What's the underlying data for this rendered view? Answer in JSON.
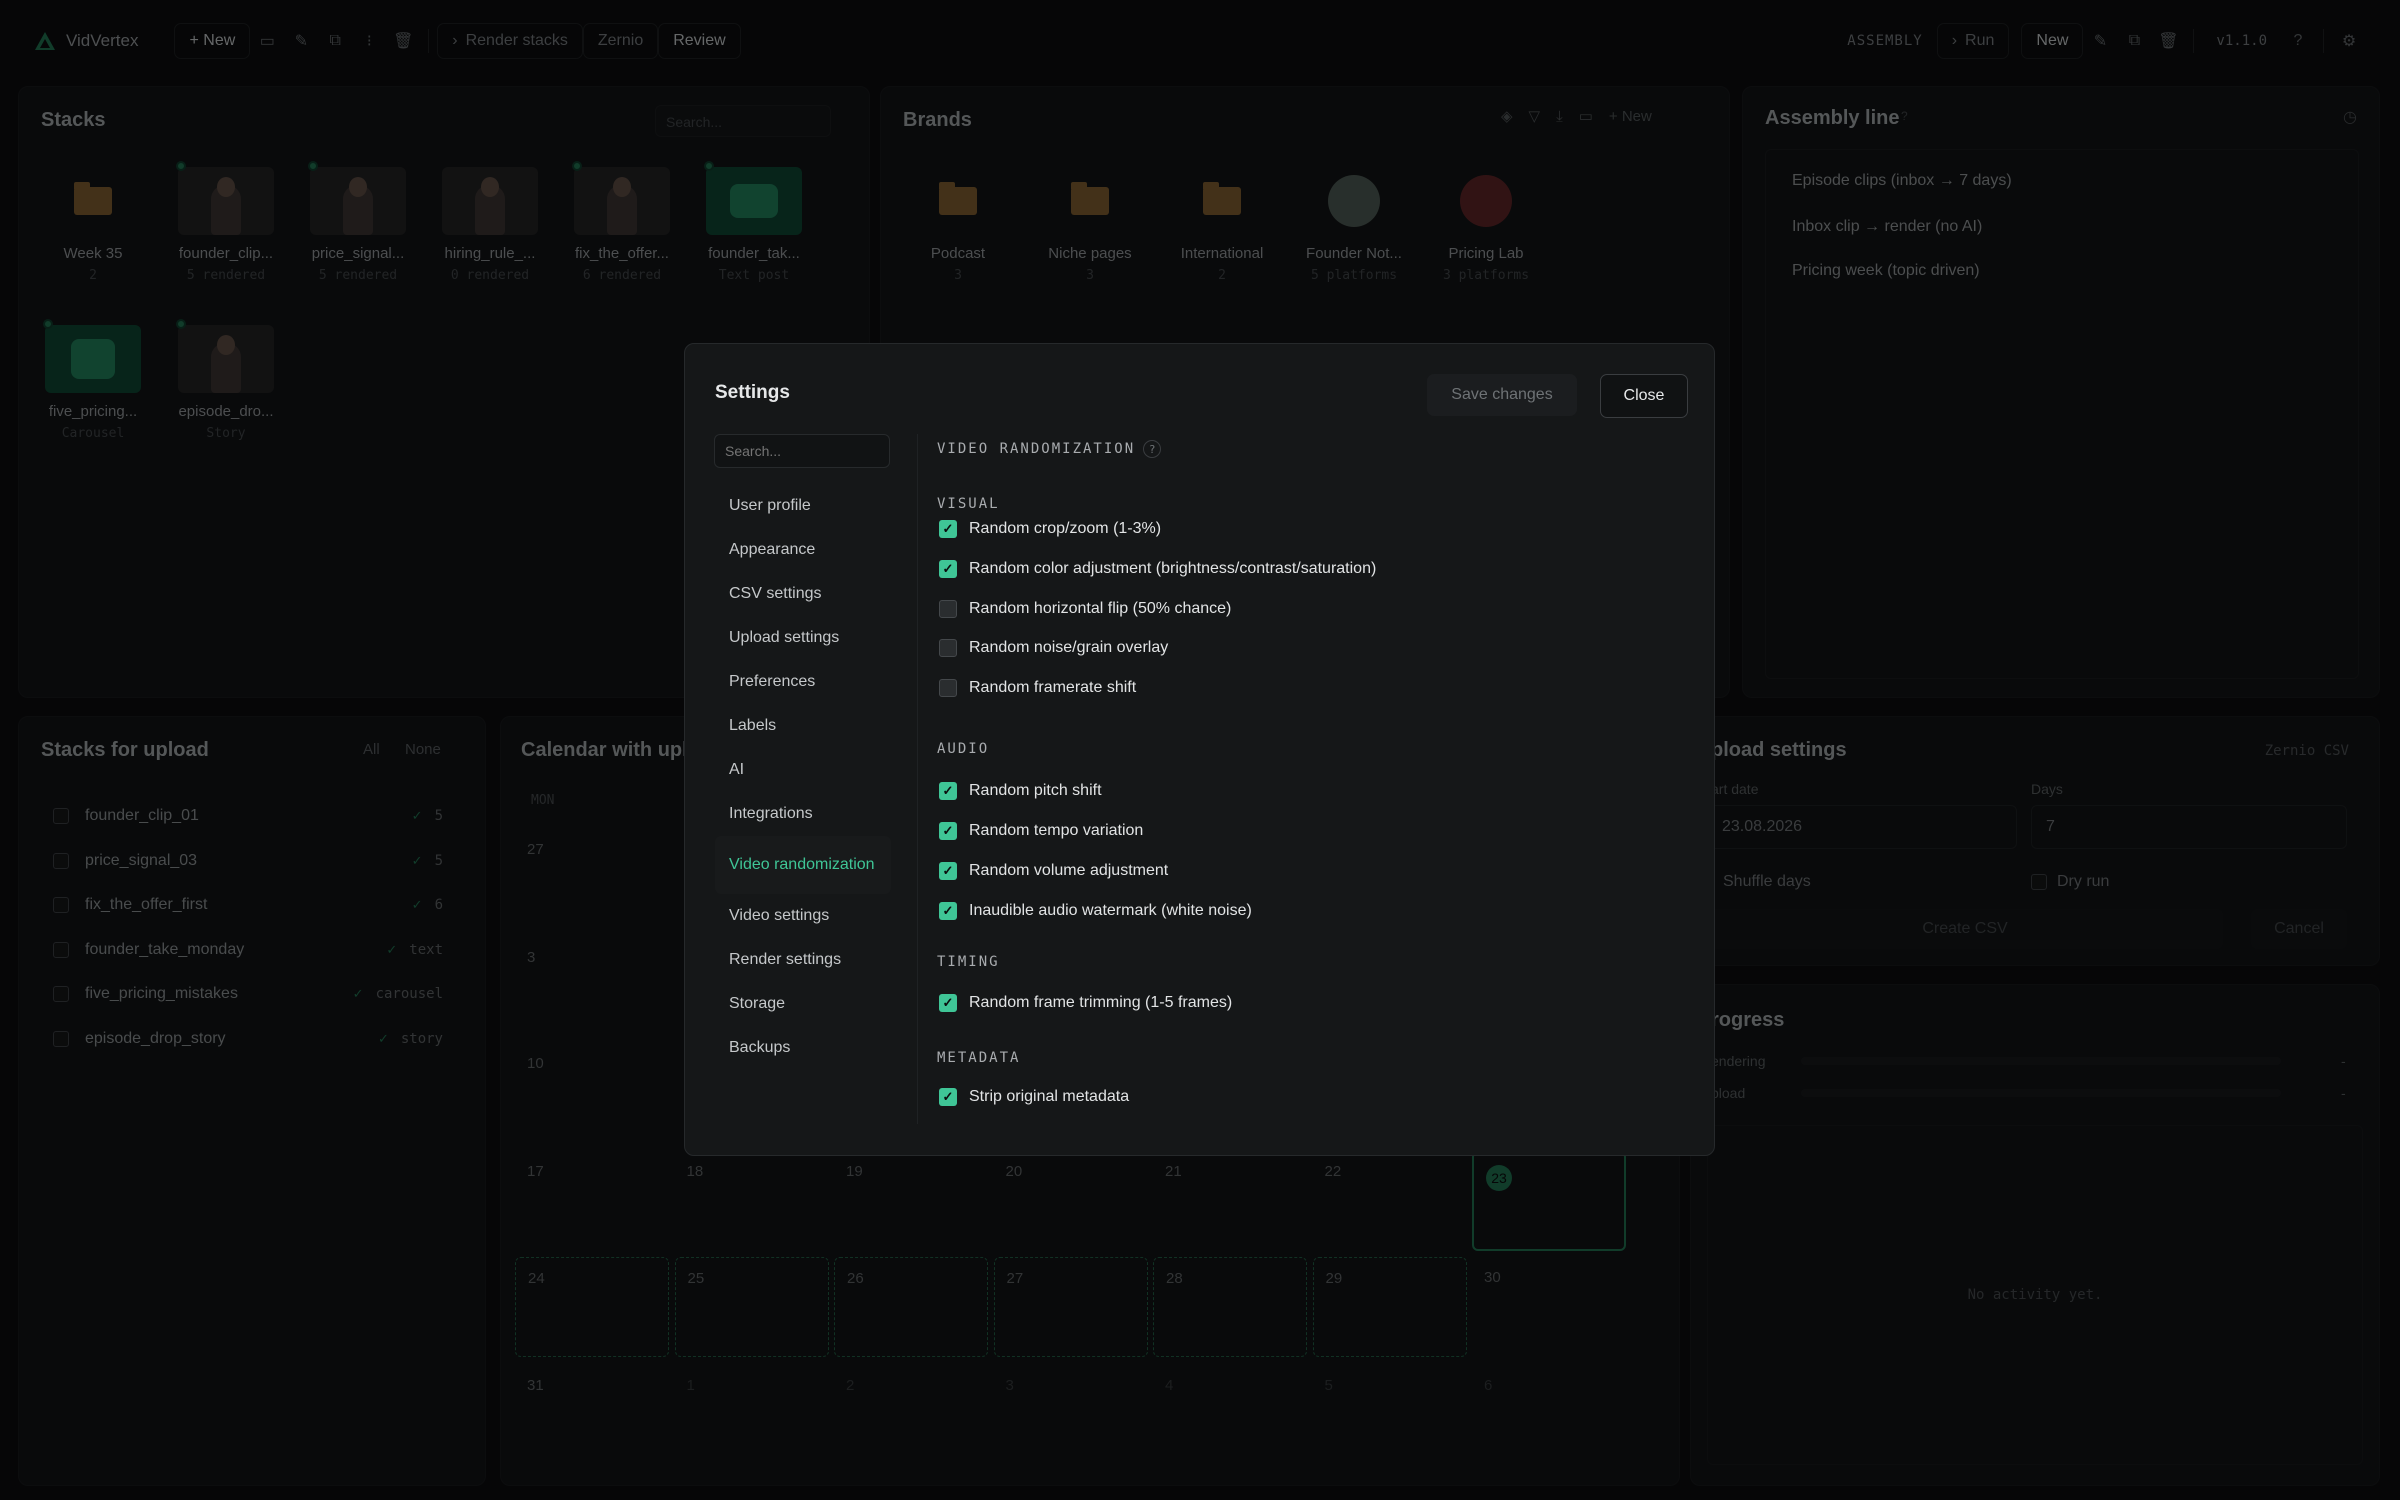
{
  "app": {
    "name": "VidVertex",
    "version": "v1.1.0"
  },
  "topbar": {
    "new_label": "+ New",
    "render_stacks_label": "Render stacks",
    "zernio_label": "Zernio",
    "review_label": "Review",
    "assembly_label": "ASSEMBLY",
    "run_label": "Run",
    "new2_label": "New"
  },
  "stacks_panel": {
    "title": "Stacks",
    "search_placeholder": "Search...",
    "items": [
      {
        "name": "Week 35",
        "sub": "2",
        "kind": "folder"
      },
      {
        "name": "founder_clip...",
        "sub": "5 rendered",
        "kind": "video"
      },
      {
        "name": "price_signal...",
        "sub": "5 rendered",
        "kind": "video"
      },
      {
        "name": "hiring_rule_...",
        "sub": "0 rendered",
        "kind": "video"
      },
      {
        "name": "fix_the_offer...",
        "sub": "6 rendered",
        "kind": "video"
      },
      {
        "name": "founder_tak...",
        "sub": "Text post",
        "kind": "text"
      },
      {
        "name": "five_pricing...",
        "sub": "Carousel",
        "kind": "carousel"
      },
      {
        "name": "episode_dro...",
        "sub": "Story",
        "kind": "story"
      }
    ]
  },
  "brands_panel": {
    "title": "Brands",
    "new_label": "+ New",
    "items": [
      {
        "name": "Podcast",
        "sub": "3"
      },
      {
        "name": "Niche pages",
        "sub": "3"
      },
      {
        "name": "International",
        "sub": "2"
      },
      {
        "name": "Founder Not...",
        "sub": "5 platforms"
      },
      {
        "name": "Pricing Lab",
        "sub": "3 platforms"
      }
    ]
  },
  "assembly_panel": {
    "title": "Assembly line",
    "items": [
      "Episode clips (inbox → 7 days)",
      "Inbox clip → render (no AI)",
      "Pricing week (topic driven)"
    ]
  },
  "upload_panel": {
    "title": "Stacks for upload",
    "all_label": "All",
    "none_label": "None",
    "rows": [
      {
        "name": "founder_clip_01",
        "count": "5"
      },
      {
        "name": "price_signal_03",
        "count": "5"
      },
      {
        "name": "fix_the_offer_first",
        "count": "6"
      },
      {
        "name": "founder_take_monday",
        "count": "text"
      },
      {
        "name": "five_pricing_mistakes",
        "count": "carousel"
      },
      {
        "name": "episode_drop_story",
        "count": "story"
      }
    ]
  },
  "calendar": {
    "title": "Calendar with uplo",
    "mon_label": "MON",
    "row1": [
      "27"
    ],
    "row2": [
      "3"
    ],
    "row3": [
      "10"
    ],
    "row4": [
      "17",
      "18",
      "19",
      "20",
      "21",
      "22",
      "23"
    ],
    "row5": [
      "24",
      "25",
      "26",
      "27",
      "28",
      "29",
      "30"
    ],
    "row6": [
      "31",
      "1",
      "2",
      "3",
      "4",
      "5",
      "6"
    ]
  },
  "upload_settings": {
    "title": "pload settings",
    "zernio_csv": "Zernio CSV",
    "start_label": "art date",
    "start_value": "23.08.2026",
    "days_label": "Days",
    "days_value": "7",
    "shuffle_label": "Shuffle days",
    "dry_run_label": "Dry run",
    "create_label": "Create CSV",
    "cancel_label": "Cancel"
  },
  "progress": {
    "title": "rogress",
    "rendering_label": "endering",
    "upload_label": "pload",
    "rendering_value": "-",
    "upload_value": "-",
    "empty_text": "No activity yet."
  },
  "settings_modal": {
    "title": "Settings",
    "save_label": "Save changes",
    "close_label": "Close",
    "search_placeholder": "Search...",
    "nav": [
      "User profile",
      "Appearance",
      "CSV settings",
      "Upload settings",
      "Preferences",
      "Labels",
      "AI",
      "Integrations",
      "Video randomization",
      "Video settings",
      "Render settings",
      "Storage",
      "Backups"
    ],
    "active_nav": "Video randomization",
    "heading": "VIDEO RANDOMIZATION",
    "sections": {
      "visual": {
        "label": "VISUAL",
        "options": [
          {
            "label": "Random crop/zoom (1-3%)",
            "checked": true
          },
          {
            "label": "Random color adjustment (brightness/contrast/saturation)",
            "checked": true
          },
          {
            "label": "Random horizontal flip (50% chance)",
            "checked": false
          },
          {
            "label": "Random noise/grain overlay",
            "checked": false
          },
          {
            "label": "Random framerate shift",
            "checked": false
          }
        ]
      },
      "audio": {
        "label": "AUDIO",
        "options": [
          {
            "label": "Random pitch shift",
            "checked": true
          },
          {
            "label": "Random tempo variation",
            "checked": true
          },
          {
            "label": "Random volume adjustment",
            "checked": true
          },
          {
            "label": "Inaudible audio watermark (white noise)",
            "checked": true
          }
        ]
      },
      "timing": {
        "label": "TIMING",
        "options": [
          {
            "label": "Random frame trimming (1-5 frames)",
            "checked": true
          }
        ]
      },
      "metadata": {
        "label": "METADATA",
        "options": [
          {
            "label": "Strip original metadata",
            "checked": true
          }
        ]
      }
    }
  },
  "colors": {
    "accent": "#3fc596",
    "background": "#0b0c0d",
    "panel": "#111314",
    "modal": "#151718"
  }
}
